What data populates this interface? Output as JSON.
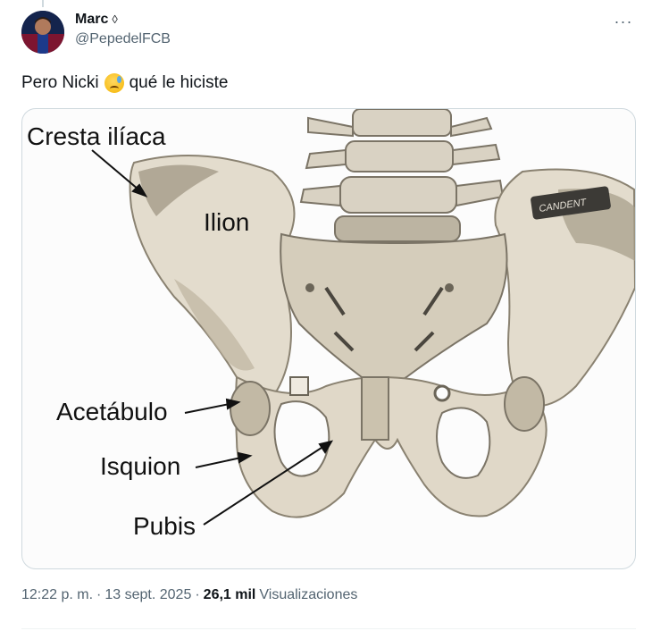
{
  "author": {
    "display_name": "Marc",
    "badge_symbol": "◊",
    "handle": "@PepedelFCB"
  },
  "more_menu_label": "···",
  "tweet": {
    "text_before_emoji": "Pero Nicki",
    "emoji": "anxious-face-with-sweat",
    "text_after_emoji": "qué le hiciste"
  },
  "image": {
    "description_labels": {
      "cresta": "Cresta ilíaca",
      "ilion": "Ilion",
      "acetabulo": "Acetábulo",
      "isquion": "Isquion",
      "pubis": "Pubis",
      "brand": "CANDENT"
    },
    "colors": {
      "bone_light": "#e6e0d2",
      "bone_mid": "#cfc6b3",
      "bone_dark": "#9e9582",
      "shadow": "#6f6a5f"
    }
  },
  "meta": {
    "time": "12:22 p. m.",
    "separator": "·",
    "date": "13 sept. 2025",
    "views_count": "26,1 mil",
    "views_label": "Visualizaciones"
  }
}
